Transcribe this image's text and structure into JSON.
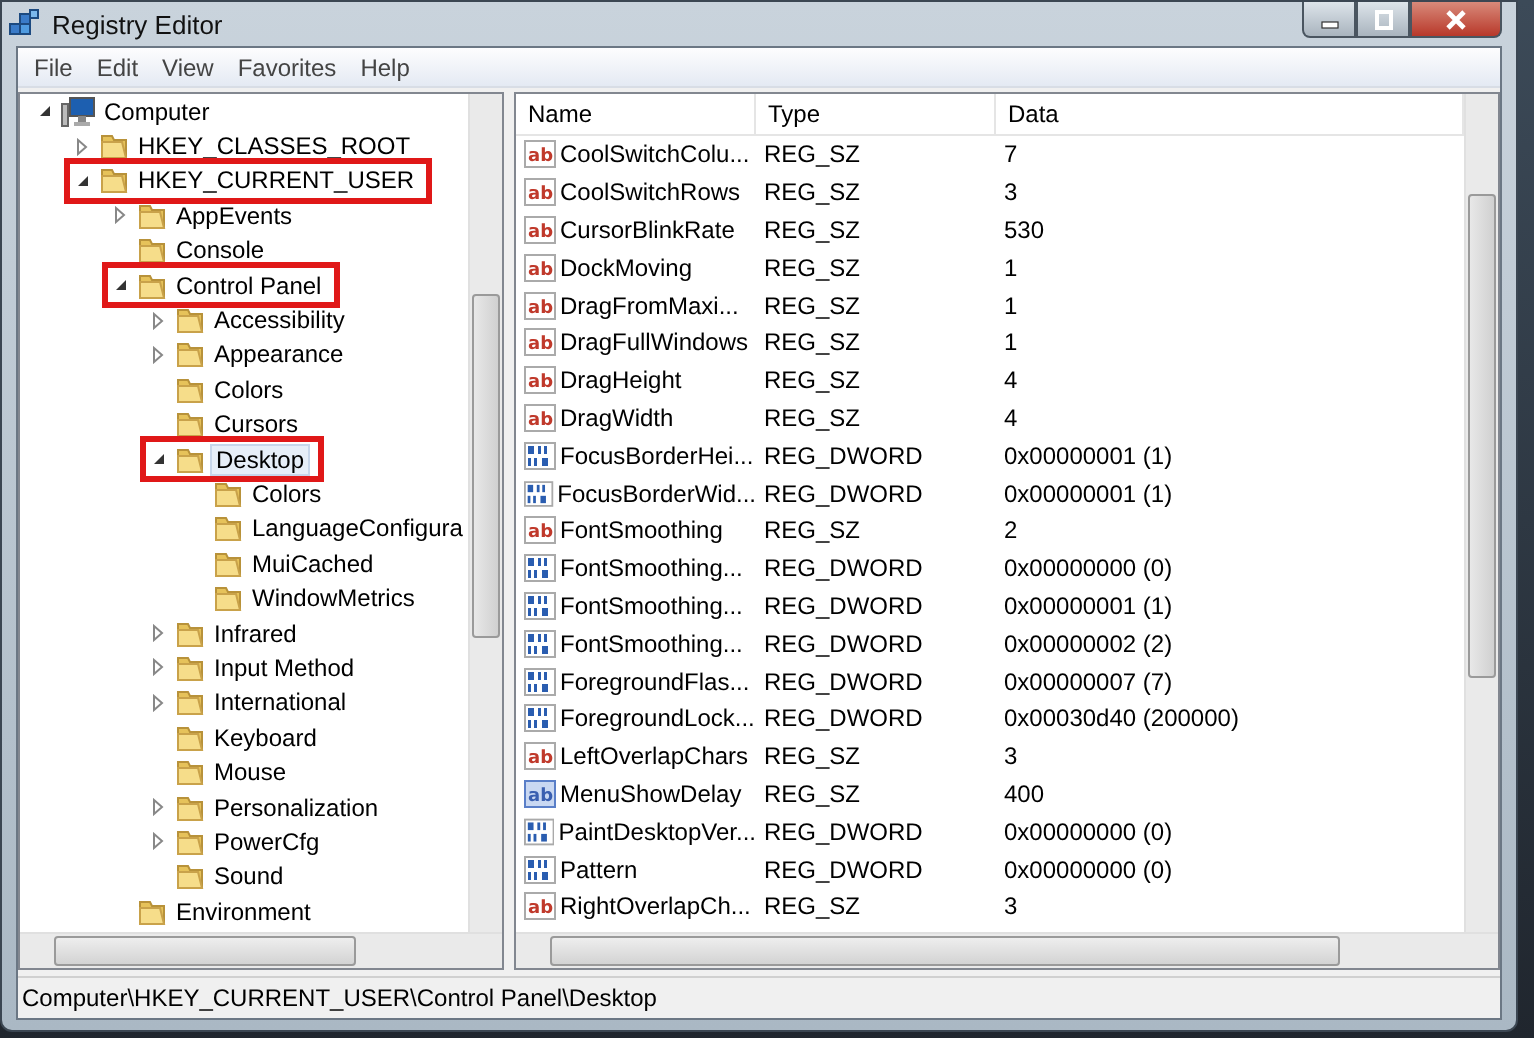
{
  "window": {
    "title": "Registry Editor"
  },
  "menu": [
    "File",
    "Edit",
    "View",
    "Favorites",
    "Help"
  ],
  "tree": [
    {
      "label": "Computer",
      "kind": "computer",
      "expanded": true,
      "marked": false,
      "selected": false,
      "children": [
        {
          "label": "HKEY_CLASSES_ROOT",
          "kind": "folder",
          "expanded": false,
          "marked": false,
          "selected": false
        },
        {
          "label": "HKEY_CURRENT_USER",
          "kind": "folder",
          "expanded": true,
          "marked": true,
          "selected": false,
          "children": [
            {
              "label": "AppEvents",
              "kind": "folder",
              "expanded": false,
              "marked": false,
              "selected": false
            },
            {
              "label": "Console",
              "kind": "folder",
              "marked": false,
              "selected": false
            },
            {
              "label": "Control Panel",
              "kind": "folder",
              "expanded": true,
              "marked": true,
              "selected": false,
              "children": [
                {
                  "label": "Accessibility",
                  "kind": "folder",
                  "expanded": false,
                  "marked": false,
                  "selected": false
                },
                {
                  "label": "Appearance",
                  "kind": "folder",
                  "expanded": false,
                  "marked": false,
                  "selected": false
                },
                {
                  "label": "Colors",
                  "kind": "folder",
                  "marked": false,
                  "selected": false
                },
                {
                  "label": "Cursors",
                  "kind": "folder",
                  "marked": false,
                  "selected": false
                },
                {
                  "label": "Desktop",
                  "kind": "folder",
                  "expanded": true,
                  "marked": true,
                  "selected": true,
                  "children": [
                    {
                      "label": "Colors",
                      "kind": "folder",
                      "marked": false,
                      "selected": false
                    },
                    {
                      "label": "LanguageConfigura",
                      "kind": "folder",
                      "marked": false,
                      "selected": false
                    },
                    {
                      "label": "MuiCached",
                      "kind": "folder",
                      "marked": false,
                      "selected": false
                    },
                    {
                      "label": "WindowMetrics",
                      "kind": "folder",
                      "marked": false,
                      "selected": false
                    }
                  ]
                },
                {
                  "label": "Infrared",
                  "kind": "folder",
                  "expanded": false,
                  "marked": false,
                  "selected": false
                },
                {
                  "label": "Input Method",
                  "kind": "folder",
                  "expanded": false,
                  "marked": false,
                  "selected": false
                },
                {
                  "label": "International",
                  "kind": "folder",
                  "expanded": false,
                  "marked": false,
                  "selected": false
                },
                {
                  "label": "Keyboard",
                  "kind": "folder",
                  "marked": false,
                  "selected": false
                },
                {
                  "label": "Mouse",
                  "kind": "folder",
                  "marked": false,
                  "selected": false
                },
                {
                  "label": "Personalization",
                  "kind": "folder",
                  "expanded": false,
                  "marked": false,
                  "selected": false
                },
                {
                  "label": "PowerCfg",
                  "kind": "folder",
                  "expanded": false,
                  "marked": false,
                  "selected": false
                },
                {
                  "label": "Sound",
                  "kind": "folder",
                  "marked": false,
                  "selected": false
                }
              ]
            },
            {
              "label": "Environment",
              "kind": "folder",
              "marked": false,
              "selected": false
            }
          ]
        }
      ]
    }
  ],
  "table": {
    "columns": [
      "Name",
      "Type",
      "Data"
    ],
    "rows": [
      {
        "kind": "string",
        "icon_text": "ab",
        "selected": false,
        "name": "CoolSwitchColu...",
        "type": "REG_SZ",
        "data": "7"
      },
      {
        "kind": "string",
        "icon_text": "ab",
        "selected": false,
        "name": "CoolSwitchRows",
        "type": "REG_SZ",
        "data": "3"
      },
      {
        "kind": "string",
        "icon_text": "ab",
        "selected": false,
        "name": "CursorBlinkRate",
        "type": "REG_SZ",
        "data": "530"
      },
      {
        "kind": "string",
        "icon_text": "ab",
        "selected": false,
        "name": "DockMoving",
        "type": "REG_SZ",
        "data": "1"
      },
      {
        "kind": "string",
        "icon_text": "ab",
        "selected": false,
        "name": "DragFromMaxi...",
        "type": "REG_SZ",
        "data": "1"
      },
      {
        "kind": "string",
        "icon_text": "ab",
        "selected": false,
        "name": "DragFullWindows",
        "type": "REG_SZ",
        "data": "1"
      },
      {
        "kind": "string",
        "icon_text": "ab",
        "selected": false,
        "name": "DragHeight",
        "type": "REG_SZ",
        "data": "4"
      },
      {
        "kind": "string",
        "icon_text": "ab",
        "selected": false,
        "name": "DragWidth",
        "type": "REG_SZ",
        "data": "4"
      },
      {
        "kind": "binary",
        "selected": false,
        "name": "FocusBorderHei...",
        "type": "REG_DWORD",
        "data": "0x00000001 (1)"
      },
      {
        "kind": "binary",
        "selected": false,
        "name": "FocusBorderWid...",
        "type": "REG_DWORD",
        "data": "0x00000001 (1)"
      },
      {
        "kind": "string",
        "icon_text": "ab",
        "selected": false,
        "name": "FontSmoothing",
        "type": "REG_SZ",
        "data": "2"
      },
      {
        "kind": "binary",
        "selected": false,
        "name": "FontSmoothing...",
        "type": "REG_DWORD",
        "data": "0x00000000 (0)"
      },
      {
        "kind": "binary",
        "selected": false,
        "name": "FontSmoothing...",
        "type": "REG_DWORD",
        "data": "0x00000001 (1)"
      },
      {
        "kind": "binary",
        "selected": false,
        "name": "FontSmoothing...",
        "type": "REG_DWORD",
        "data": "0x00000002 (2)"
      },
      {
        "kind": "binary",
        "selected": false,
        "name": "ForegroundFlas...",
        "type": "REG_DWORD",
        "data": "0x00000007 (7)"
      },
      {
        "kind": "binary",
        "selected": false,
        "name": "ForegroundLock...",
        "type": "REG_DWORD",
        "data": "0x00030d40 (200000)"
      },
      {
        "kind": "string",
        "icon_text": "ab",
        "selected": false,
        "name": "LeftOverlapChars",
        "type": "REG_SZ",
        "data": "3"
      },
      {
        "kind": "string",
        "icon_text": "ab",
        "selected": true,
        "name": "MenuShowDelay",
        "type": "REG_SZ",
        "data": "400"
      },
      {
        "kind": "binary",
        "selected": false,
        "name": "PaintDesktopVer...",
        "type": "REG_DWORD",
        "data": "0x00000000 (0)"
      },
      {
        "kind": "binary",
        "selected": false,
        "name": "Pattern",
        "type": "REG_DWORD",
        "data": "0x00000000 (0)"
      },
      {
        "kind": "string",
        "icon_text": "ab",
        "selected": false,
        "name": "RightOverlapCh...",
        "type": "REG_SZ",
        "data": "3"
      }
    ]
  },
  "status_bar": "Computer\\HKEY_CURRENT_USER\\Control Panel\\Desktop"
}
